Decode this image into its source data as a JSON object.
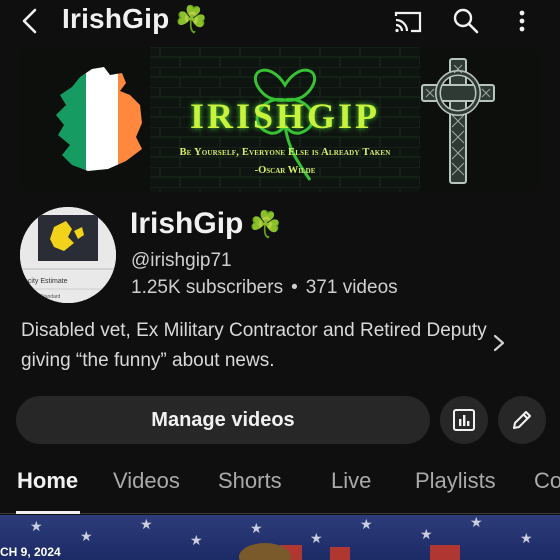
{
  "topbar": {
    "title": "IrishGip",
    "title_emoji": "☘️",
    "icons": [
      "back-icon",
      "cast-icon",
      "search-icon",
      "more-icon"
    ]
  },
  "banner": {
    "title": "IRISHGIP",
    "quote": "Be Yourself, Everyone Else is Already Taken",
    "author": "-Oscar Wilde"
  },
  "channel": {
    "name": "IrishGip",
    "name_emoji": "☘️",
    "handle": "@irishgip71",
    "subscribers": "1.25K subscribers",
    "videos": "371 videos",
    "separator": "•",
    "description": "Disabled vet, Ex Military Contractor and Retired Deputy giving “the funny” about news."
  },
  "avatar_text": {
    "line1": "acity Estimate",
    "line2": "Standard"
  },
  "actions": {
    "manage_videos": "Manage videos"
  },
  "tabs": [
    "Home",
    "Videos",
    "Shorts",
    "Live",
    "Playlists",
    "Co"
  ],
  "active_tab": "Home",
  "thumbnail": {
    "date": "CH 9, 2024"
  },
  "colors": {
    "background": "#0f0f0f",
    "button_bg": "#272727",
    "clover": "#3fae49",
    "banner_title": "#c9f23d"
  }
}
